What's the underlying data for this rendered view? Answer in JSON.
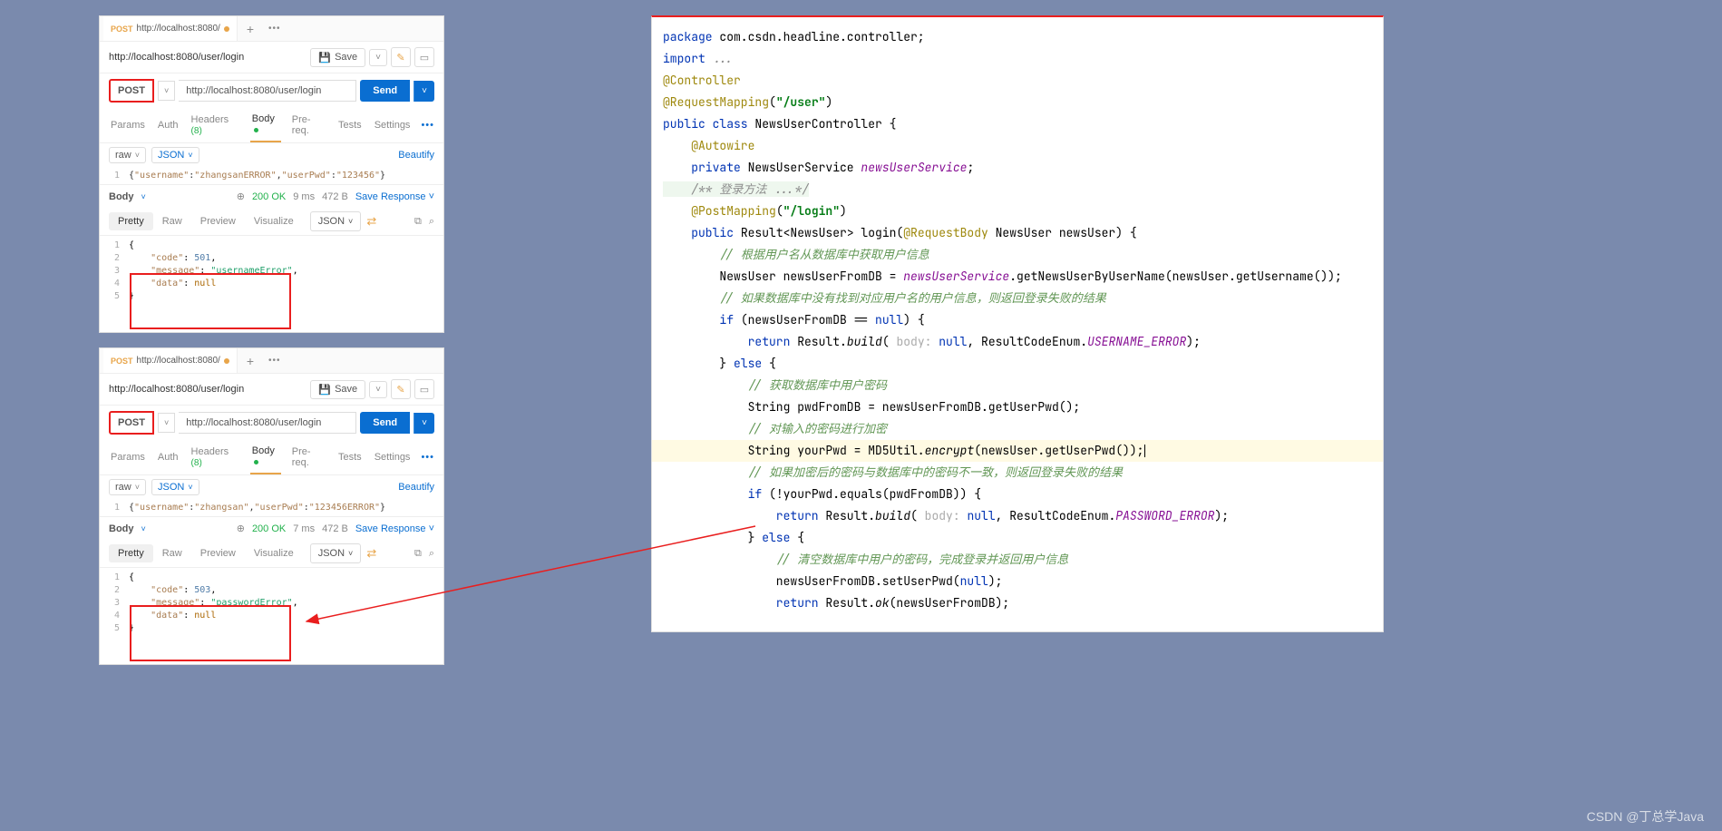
{
  "postman1": {
    "tab_method": "POST",
    "tab_title": "http://localhost:8080/",
    "plus": "+",
    "more": "•••",
    "req_name": "http://localhost:8080/user/login",
    "save_label": "Save",
    "method": "POST",
    "url": "http://localhost:8080/user/login",
    "send_label": "Send",
    "tabs": {
      "params": "Params",
      "auth": "Auth",
      "headers": "Headers",
      "headers_count": "(8)",
      "body": "Body",
      "prereq": "Pre-req.",
      "tests": "Tests",
      "settings": "Settings"
    },
    "raw": "raw",
    "json": "JSON",
    "beautify": "Beautify",
    "body_line_no": "1",
    "body_text_prefix": "{",
    "body_k1": "\"username\"",
    "body_v1": "\"zhangsanERROR\"",
    "body_k2": "\"userPwd\"",
    "body_v2": "\"123456\"",
    "body_text_suffix": "}",
    "resp": {
      "body_label": "Body",
      "status": "200 OK",
      "time": "9 ms",
      "size": "472 B",
      "save_resp": "Save Response",
      "views": {
        "pretty": "Pretty",
        "raw": "Raw",
        "preview": "Preview",
        "visualize": "Visualize"
      },
      "json_label": "JSON",
      "lines": [
        "1",
        "2",
        "3",
        "4",
        "5"
      ],
      "code_key": "\"code\"",
      "code_val": "501",
      "msg_key": "\"message\"",
      "msg_val": "\"usernameError\"",
      "data_key": "\"data\"",
      "data_val": "null"
    }
  },
  "postman2": {
    "tab_method": "POST",
    "tab_title": "http://localhost:8080/",
    "plus": "+",
    "more": "•••",
    "req_name": "http://localhost:8080/user/login",
    "save_label": "Save",
    "method": "POST",
    "url": "http://localhost:8080/user/login",
    "send_label": "Send",
    "tabs": {
      "params": "Params",
      "auth": "Auth",
      "headers": "Headers",
      "headers_count": "(8)",
      "body": "Body",
      "prereq": "Pre-req.",
      "tests": "Tests",
      "settings": "Settings"
    },
    "raw": "raw",
    "json": "JSON",
    "beautify": "Beautify",
    "body_line_no": "1",
    "body_text_prefix": "{",
    "body_k1": "\"username\"",
    "body_v1": "\"zhangsan\"",
    "body_k2": "\"userPwd\"",
    "body_v2": "\"123456ERROR\"",
    "body_text_suffix": "}",
    "resp": {
      "body_label": "Body",
      "status": "200 OK",
      "time": "7 ms",
      "size": "472 B",
      "save_resp": "Save Response",
      "views": {
        "pretty": "Pretty",
        "raw": "Raw",
        "preview": "Preview",
        "visualize": "Visualize"
      },
      "json_label": "JSON",
      "lines": [
        "1",
        "2",
        "3",
        "4",
        "5"
      ],
      "code_key": "\"code\"",
      "code_val": "503",
      "msg_key": "\"message\"",
      "msg_val": "\"passwordError\"",
      "data_key": "\"data\"",
      "data_val": "null"
    }
  },
  "java": {
    "l1_kw": "package ",
    "l1_rest": "com.csdn.headline.controller;",
    "l2_kw": "import ",
    "l2_rest": "...",
    "l3": "@Controller",
    "l4_a": "@RequestMapping",
    "l4_p": "(",
    "l4_s": "\"/user\"",
    "l4_e": ")",
    "l5_a": "public class ",
    "l5_b": "NewsUserController {",
    "l6": "    @Autowire",
    "l7_a": "    private ",
    "l7_b": "NewsUserService ",
    "l7_c": "newsUserService",
    "l7_d": ";",
    "l8": "    /** 登录方法 ...*/",
    "l9_a": "    @PostMapping",
    "l9_p": "(",
    "l9_s": "\"/login\"",
    "l9_e": ")",
    "l10_a": "    public ",
    "l10_b": "Result<NewsUser> login(",
    "l10_c": "@RequestBody ",
    "l10_d": "NewsUser newsUser) {",
    "l11": "        // 根据用户名从数据库中获取用户信息",
    "l12_a": "        NewsUser newsUserFromDB = ",
    "l12_b": "newsUserService",
    "l12_c": ".getNewsUserByUserName(newsUser.getUsername());",
    "l13": "        // 如果数据库中没有找到对应用户名的用户信息，则返回登录失败的结果",
    "l14_a": "        if ",
    "l14_b": "(newsUserFromDB == ",
    "l14_c": "null",
    "l14_d": ") {",
    "l15_a": "            return ",
    "l15_b": "Result.",
    "l15_c": "build",
    "l15_d": "(",
    "l15_h": " body: ",
    "l15_e": "null",
    "l15_f": ", ResultCodeEnum.",
    "l15_g": "USERNAME_ERROR",
    "l15_i": ");",
    "l16_a": "        } ",
    "l16_b": "else ",
    "l16_c": "{",
    "l17": "            // 获取数据库中用户密码",
    "l18": "            String pwdFromDB = newsUserFromDB.getUserPwd();",
    "l19": "            // 对输入的密码进行加密",
    "l20_a": "            String yourPwd = MD5Util.",
    "l20_b": "encrypt",
    "l20_c": "(newsUser.getUserPwd());",
    "l21": "            // 如果加密后的密码与数据库中的密码不一致，则返回登录失败的结果",
    "l22_a": "            if ",
    "l22_b": "(!yourPwd.equals(pwdFromDB)) {",
    "l23_a": "                return ",
    "l23_b": "Result.",
    "l23_c": "build",
    "l23_d": "(",
    "l23_h": " body: ",
    "l23_e": "null",
    "l23_f": ", ResultCodeEnum.",
    "l23_g": "PASSWORD_ERROR",
    "l23_i": ");",
    "l24_a": "            } ",
    "l24_b": "else ",
    "l24_c": "{",
    "l25": "                // 清空数据库中用户的密码，完成登录并返回用户信息",
    "l26_a": "                newsUserFromDB.setUserPwd(",
    "l26_b": "null",
    "l26_c": ");",
    "l27_a": "                return ",
    "l27_b": "Result.",
    "l27_c": "ok",
    "l27_d": "(newsUserFromDB);"
  },
  "watermark": "CSDN @丁总学Java"
}
